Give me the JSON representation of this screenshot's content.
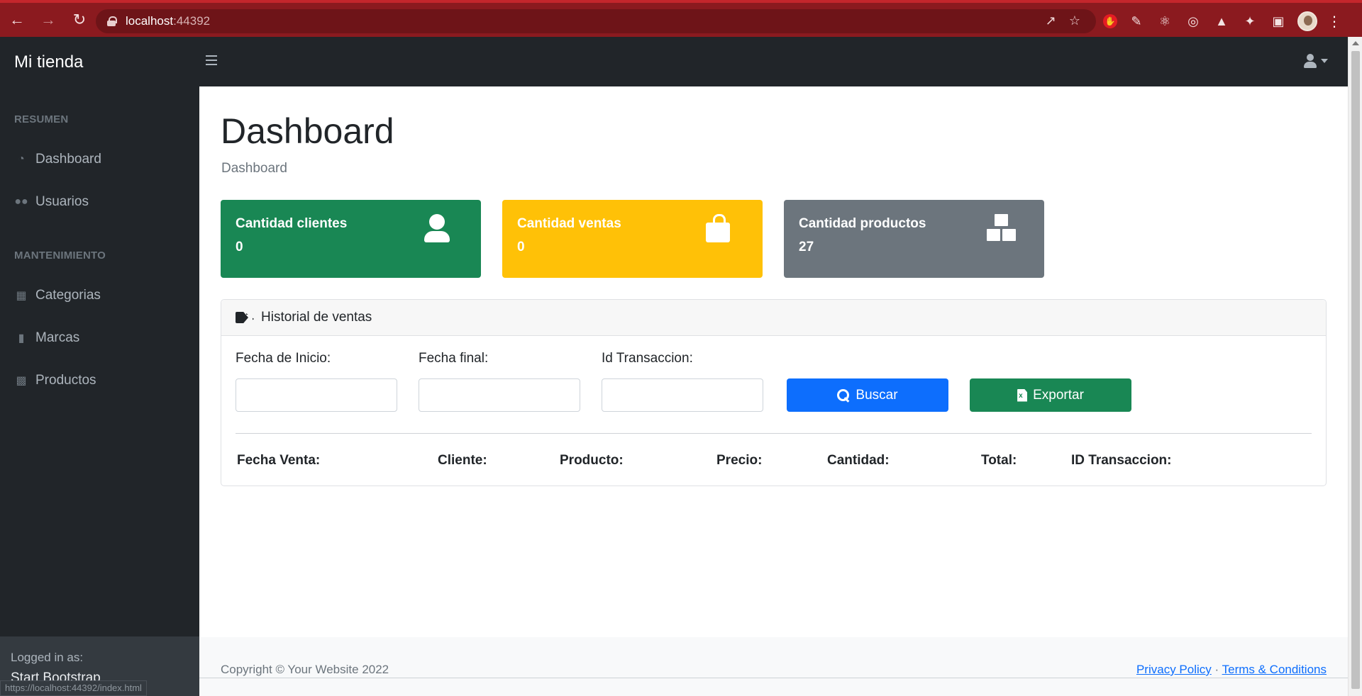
{
  "browser": {
    "url_host": "localhost",
    "url_port": ":44392",
    "status_url": "https://localhost:44392/index.html",
    "icons": [
      "back-icon",
      "forward-icon",
      "reload-icon",
      "lock-icon",
      "share-icon",
      "star-icon",
      "extension-icons",
      "profile-avatar",
      "menu-icon"
    ]
  },
  "navbar": {
    "brand": "Mi tienda"
  },
  "sidebar": {
    "headings": [
      "RESUMEN",
      "MANTENIMIENTO"
    ],
    "items": [
      {
        "label": "Dashboard",
        "icon": "gauge-icon"
      },
      {
        "label": "Usuarios",
        "icon": "users-icon"
      },
      {
        "label": "Categorias",
        "icon": "table-icon"
      },
      {
        "label": "Marcas",
        "icon": "bookmark-icon"
      },
      {
        "label": "Productos",
        "icon": "boxes-icon"
      }
    ],
    "footer": {
      "logged_label": "Logged in as:",
      "user": "Start Bootstrap"
    }
  },
  "page": {
    "title": "Dashboard",
    "breadcrumb": "Dashboard"
  },
  "cards": [
    {
      "label": "Cantidad clientes",
      "value": "0",
      "color": "#198754",
      "icon": "user-icon"
    },
    {
      "label": "Cantidad ventas",
      "value": "0",
      "color": "#ffc107",
      "icon": "shopping-bag-icon"
    },
    {
      "label": "Cantidad productos",
      "value": "27",
      "color": "#6c757d",
      "icon": "boxes-icon"
    }
  ],
  "history": {
    "title": "Historial de ventas",
    "filters": {
      "start_label": "Fecha de Inicio:",
      "end_label": "Fecha final:",
      "id_label": "Id Transaccion:",
      "start_value": "",
      "end_value": "",
      "id_value": ""
    },
    "buttons": {
      "search": "Buscar",
      "export": "Exportar"
    },
    "columns": [
      "Fecha Venta:",
      "Cliente:",
      "Producto:",
      "Precio:",
      "Cantidad:",
      "Total:",
      "ID Transaccion:"
    ]
  },
  "footer": {
    "copyright": "Copyright © Your Website 2022",
    "privacy": "Privacy Policy",
    "separator": "·",
    "terms": "Terms & Conditions"
  }
}
